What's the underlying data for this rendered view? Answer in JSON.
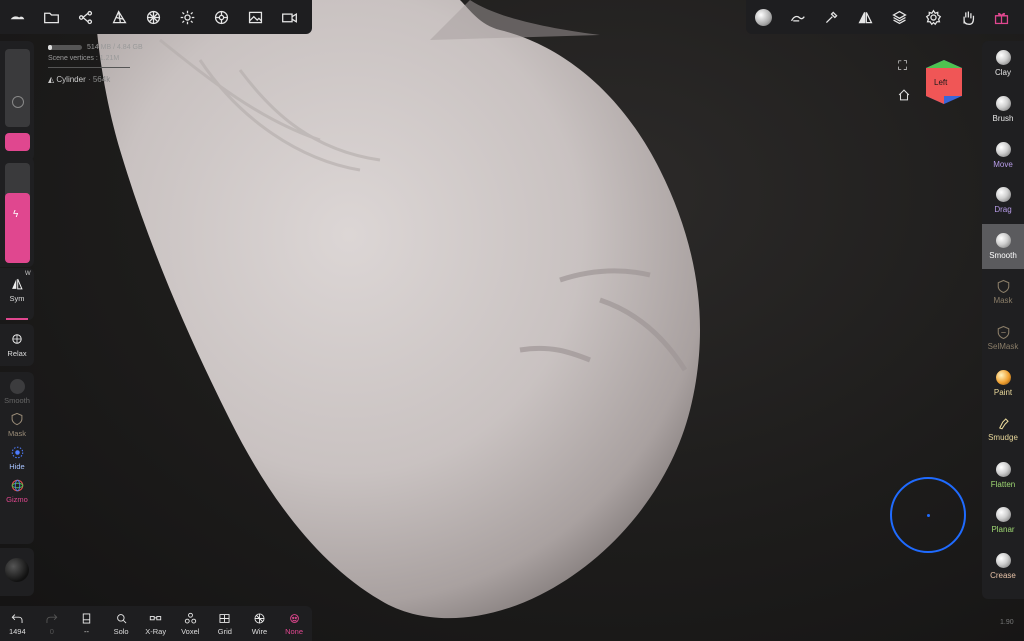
{
  "stats": {
    "memory": "514 MB / 4.84 GB",
    "memory_fraction": 0.106,
    "vertices_label": "Scene vertices :",
    "vertices_value": "1.21M"
  },
  "object": {
    "name": "Cylinder",
    "count": "564k"
  },
  "gizmo": {
    "face_label": "Left"
  },
  "left_tools": {
    "sym": "Sym",
    "sym_badge": "W",
    "relax": "Relax",
    "smooth": "Smooth",
    "mask": "Mask",
    "hide": "Hide",
    "gizmo": "Gizmo"
  },
  "right_tools": [
    {
      "label": "Clay",
      "color": "#e8e8e8"
    },
    {
      "label": "Brush",
      "color": "#e8e8e8"
    },
    {
      "label": "Move",
      "color": "#b79ce8"
    },
    {
      "label": "Drag",
      "color": "#b79ce8"
    },
    {
      "label": "Smooth",
      "color": "#e8e8e8"
    },
    {
      "label": "Mask",
      "color": "#8a7d68"
    },
    {
      "label": "SelMask",
      "color": "#8a7d68"
    },
    {
      "label": "Paint",
      "color": "#e8d79a"
    },
    {
      "label": "Smudge",
      "color": "#e8d79a"
    },
    {
      "label": "Flatten",
      "color": "#9fd873"
    },
    {
      "label": "Planar",
      "color": "#9fd873"
    },
    {
      "label": "Crease",
      "color": "#e8c3a8"
    }
  ],
  "bottom": {
    "undo_count": "1494",
    "redo_count": "0",
    "layers": "--",
    "solo": "Solo",
    "xray": "X-Ray",
    "voxel": "Voxel",
    "grid": "Grid",
    "wire": "Wire",
    "none": "None"
  },
  "version": "1.90",
  "colors": {
    "accent": "#e0478f",
    "brush_circle": "#1f6bff"
  }
}
